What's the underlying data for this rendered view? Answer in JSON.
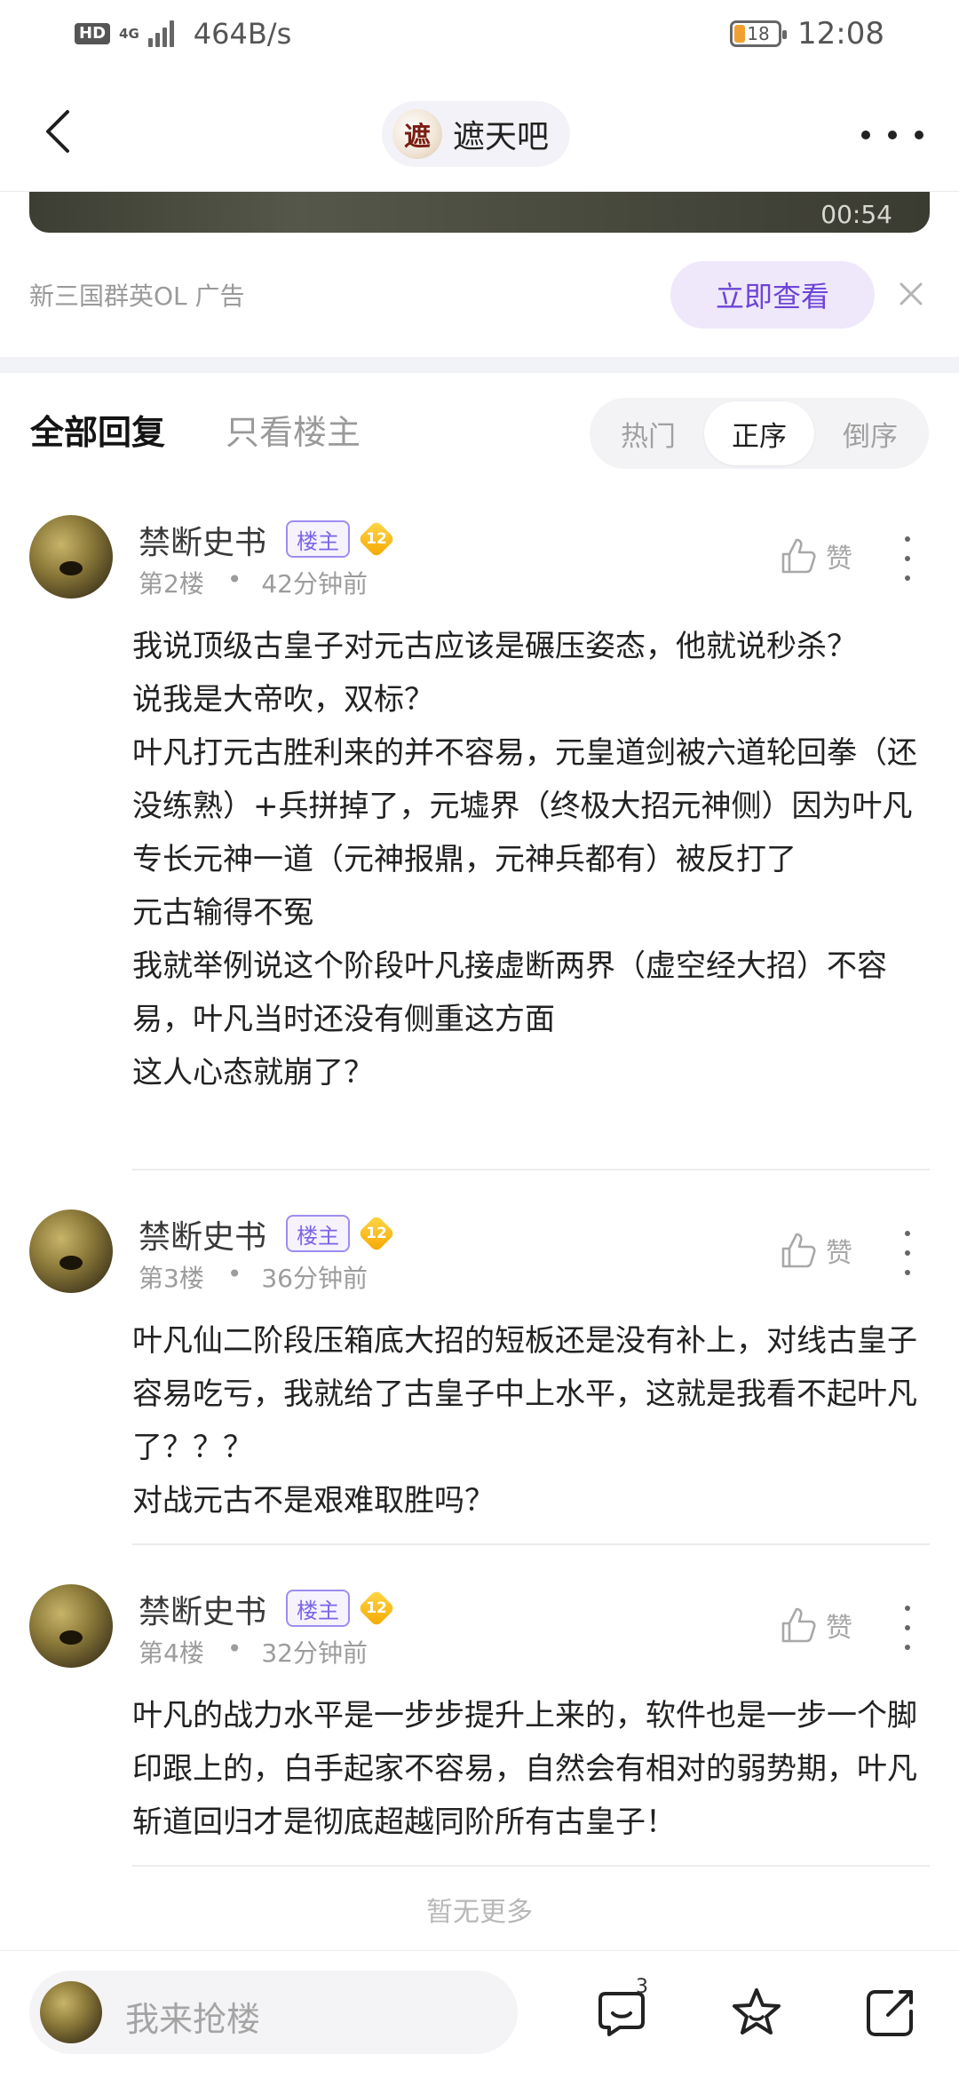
{
  "status_bar": {
    "hd": "HD",
    "network": "4G",
    "speed": "464B/s",
    "battery": "18",
    "time": "12:08"
  },
  "header": {
    "forum_logo_text": "遮",
    "forum_name": "遮天吧"
  },
  "ad": {
    "video_time": "00:54",
    "source": "新三国群英OL  广告",
    "cta": "立即查看"
  },
  "filters": {
    "all_replies": "全部回复",
    "owner_only": "只看楼主",
    "sort": [
      "热门",
      "正序",
      "倒序"
    ],
    "active_sort": "正序"
  },
  "posts": [
    {
      "username": "禁断史书",
      "tag": "楼主",
      "level": "12",
      "floor": "第2楼",
      "time": "42分钟前",
      "like": "赞",
      "content": "我说顶级古皇子对元古应该是碾压姿态，他就说秒杀？\n说我是大帝吹，双标？\n叶凡打元古胜利来的并不容易，元皇道剑被六道轮回拳（还没练熟）+兵拼掉了，元墟界（终极大招元神侧）因为叶凡专长元神一道（元神报鼎，元神兵都有）被反打了\n元古输得不冤\n我就举例说这个阶段叶凡接虚断两界（虚空经大招）不容易，叶凡当时还没有侧重这方面\n这人心态就崩了？"
    },
    {
      "username": "禁断史书",
      "tag": "楼主",
      "level": "12",
      "floor": "第3楼",
      "time": "36分钟前",
      "like": "赞",
      "content": "叶凡仙二阶段压箱底大招的短板还是没有补上，对线古皇子容易吃亏，我就给了古皇子中上水平，这就是我看不起叶凡了？？？\n对战元古不是艰难取胜吗？"
    },
    {
      "username": "禁断史书",
      "tag": "楼主",
      "level": "12",
      "floor": "第4楼",
      "time": "32分钟前",
      "like": "赞",
      "content": "叶凡的战力水平是一步步提升上来的，软件也是一步一个脚印跟上的，白手起家不容易，自然会有相对的弱势期，叶凡斩道回归才是彻底超越同阶所有古皇子！"
    }
  ],
  "footer": {
    "no_more": "暂无更多",
    "reply_placeholder": "我来抢楼",
    "comment_count": "3"
  }
}
